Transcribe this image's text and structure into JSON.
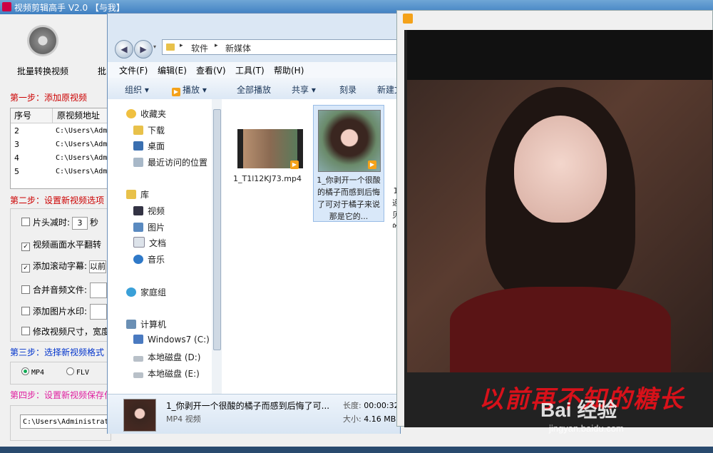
{
  "app": {
    "title": "视频剪辑高手 V2.0 【与我】",
    "tool_label": "批量转换视频",
    "tool_label_cut": "批",
    "step1": "第一步：添加原视频",
    "table_headers": [
      "序号",
      "原视频地址"
    ],
    "rows": [
      {
        "n": "2",
        "path": "C:\\Users\\Adm"
      },
      {
        "n": "3",
        "path": "C:\\Users\\Adm"
      },
      {
        "n": "4",
        "path": "C:\\Users\\Adm"
      },
      {
        "n": "5",
        "path": "C:\\Users\\Adm"
      }
    ],
    "step2": "第二步：设置新视频选项",
    "opt_trim": "片头减时:",
    "opt_trim_value": "3",
    "opt_trim_unit": "秒",
    "opt_flip": "视频画面水平翻转",
    "opt_subtitle": "添加滚动字幕:",
    "opt_subtitle_value": "以前",
    "opt_audio": "合并音频文件:",
    "opt_watermark": "添加图片水印:",
    "opt_resize": "修改视频尺寸，宽度",
    "step3": "第三步：选择新视频格式",
    "fmt_mp4": "MP4",
    "fmt_flv": "FLV",
    "step4": "第四步：设置新视频保存位",
    "save_path": "C:\\Users\\Administrat",
    "accent": "#c00000"
  },
  "explorer": {
    "breadcrumb": [
      "软件",
      "新媒体"
    ],
    "menu": [
      "文件(F)",
      "编辑(E)",
      "查看(V)",
      "工具(T)",
      "帮助(H)"
    ],
    "commands": [
      "组织 ▾",
      "播放 ▾",
      "全部播放",
      "共享 ▾",
      "刻录",
      "新建文"
    ],
    "nav": {
      "favorites": "收藏夹",
      "downloads": "下载",
      "desktop": "桌面",
      "recent": "最近访问的位置",
      "libraries": "库",
      "videos": "视频",
      "pictures": "图片",
      "documents": "文档",
      "music": "音乐",
      "homegroup": "家庭组",
      "computer": "计算机",
      "drive_c": "Windows7 (C:)",
      "drive_d": "本地磁盘 (D:)",
      "drive_e": "本地磁盘 (E:)"
    },
    "files": [
      {
        "name": "1_T1l12KJ73.mp4"
      },
      {
        "name": "1_你剥开一个很酸的橘子而感到后悔了可对于橘子来说那是它的..."
      }
    ],
    "partial_label": "1 递 贝 的",
    "details": {
      "name": "1_你剥开一个很酸的橘子而感到后悔了可...",
      "type": "MP4 视频",
      "duration_label": "长度:",
      "duration": "00:00:32",
      "size_label": "大小:",
      "size": "4.16 MB"
    }
  },
  "player": {
    "subtitle": "以前再不知的糖长",
    "watermark": "Bai 经验",
    "watermark_url": "jingyan.baidu.com"
  }
}
